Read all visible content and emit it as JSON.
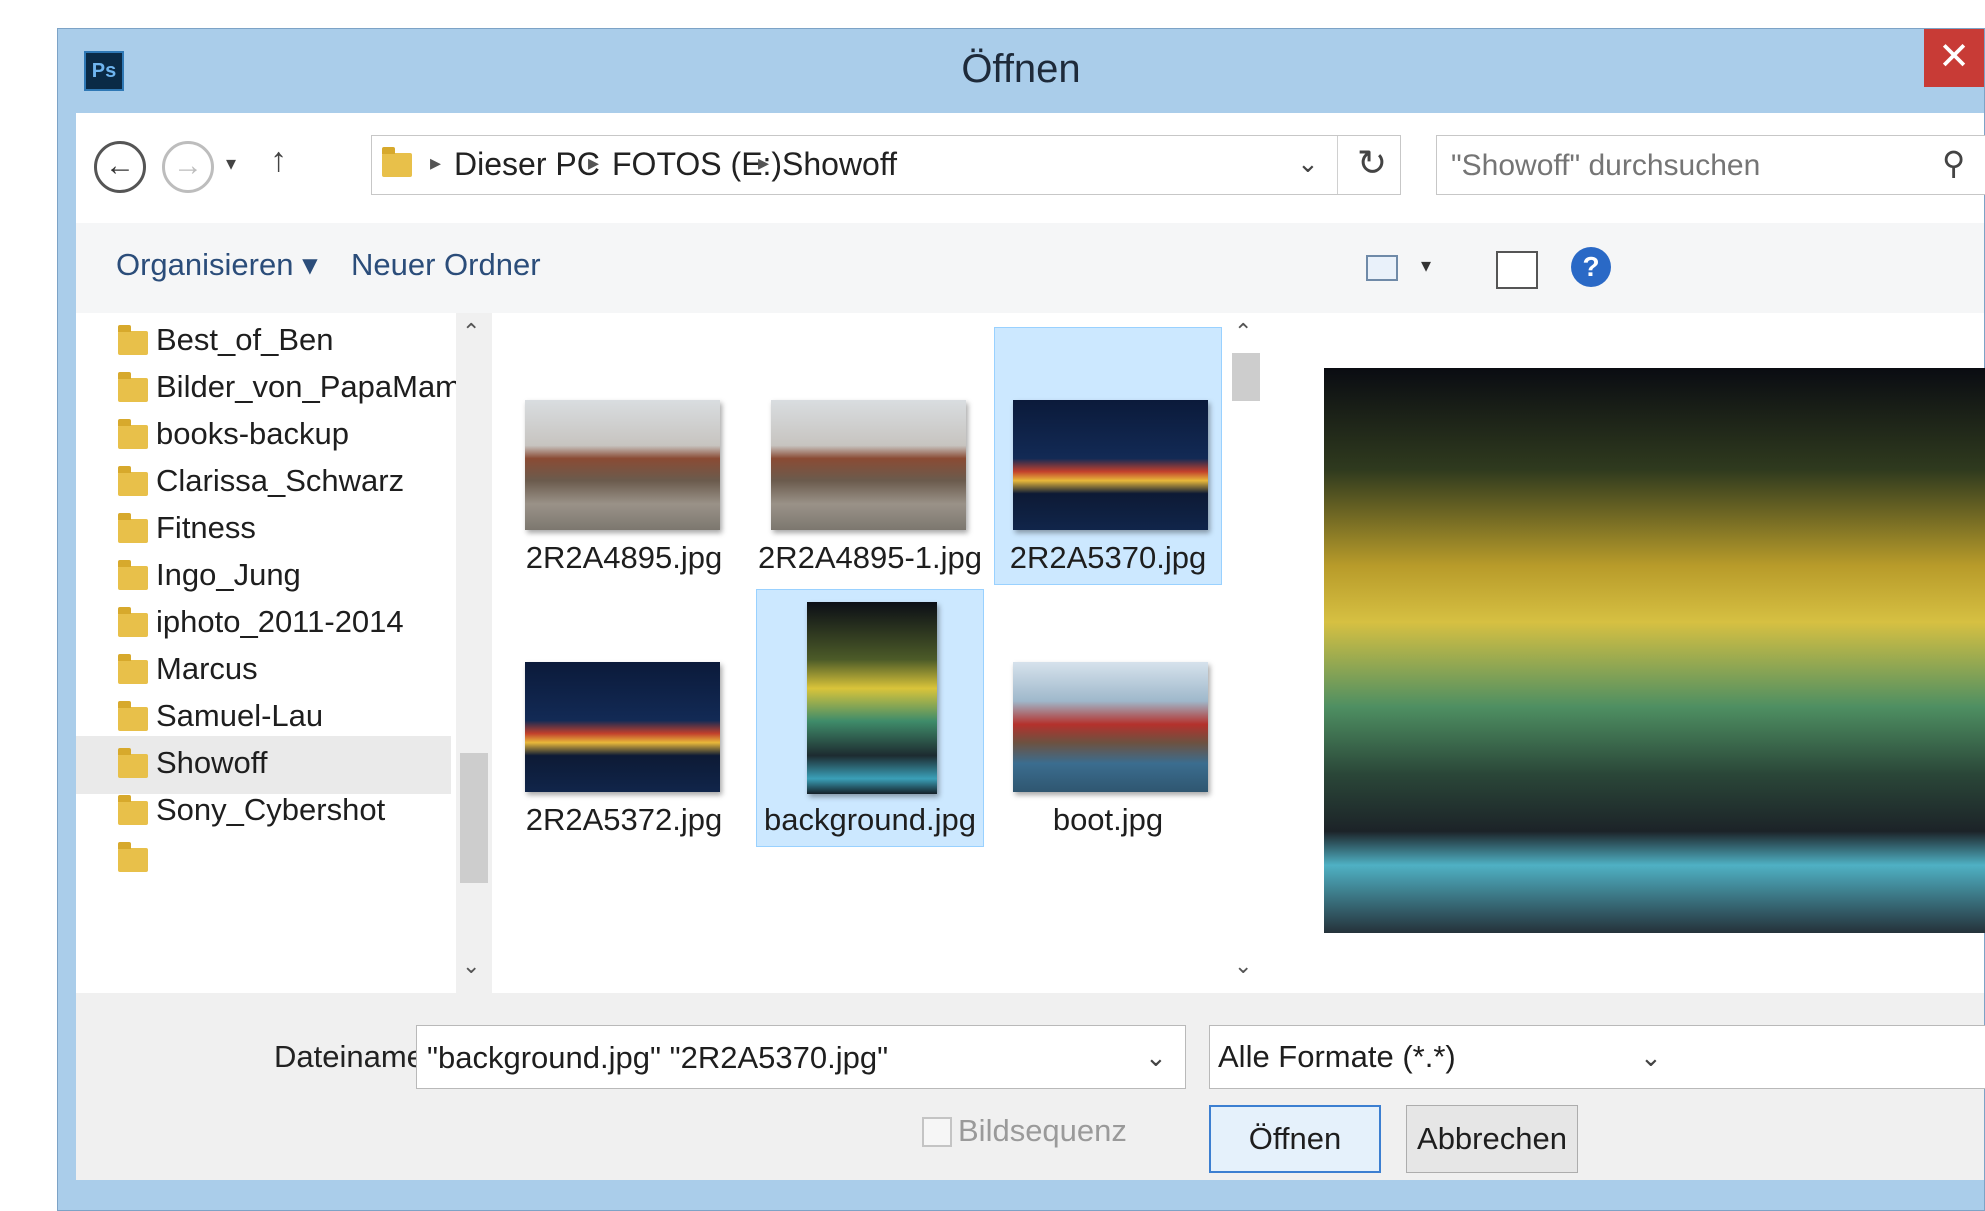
{
  "window": {
    "title": "Öffnen",
    "app_icon": "Ps",
    "close_glyph": "✕"
  },
  "nav": {
    "back_glyph": "←",
    "forward_glyph": "→",
    "recent_glyph": "▾",
    "up_glyph": "↑"
  },
  "address": {
    "crumbs": [
      "Dieser PC",
      "FOTOS (E:)",
      "Showoff"
    ],
    "separator_glyph": "▸",
    "dropdown_glyph": "⌄",
    "refresh_glyph": "↻"
  },
  "search": {
    "placeholder": "\"Showoff\" durchsuchen",
    "icon_glyph": "⚲"
  },
  "toolbar": {
    "organize_label": "Organisieren ▾",
    "new_folder_label": "Neuer Ordner",
    "view_caret": "▾",
    "help_glyph": "?"
  },
  "sidebar": {
    "items": [
      {
        "label": "Best_of_Ben",
        "selected": false
      },
      {
        "label": "Bilder_von_PapaMama",
        "selected": false
      },
      {
        "label": "books-backup",
        "selected": false
      },
      {
        "label": "Clarissa_Schwarz",
        "selected": false
      },
      {
        "label": "Fitness",
        "selected": false
      },
      {
        "label": "Ingo_Jung",
        "selected": false
      },
      {
        "label": "iphoto_2011-2014",
        "selected": false
      },
      {
        "label": "Marcus",
        "selected": false
      },
      {
        "label": "Samuel-Lau",
        "selected": false
      },
      {
        "label": "Showoff",
        "selected": true
      },
      {
        "label": "Sony_Cybershot",
        "selected": false
      }
    ],
    "scroll_up_glyph": "⌃",
    "scroll_down_glyph": "⌄"
  },
  "files": {
    "items": [
      {
        "name": "2R2A4895.jpg",
        "thumb": "temple",
        "selected": false
      },
      {
        "name": "2R2A4895-1.jpg",
        "thumb": "temple",
        "selected": false
      },
      {
        "name": "2R2A5370.jpg",
        "thumb": "bird",
        "selected": true
      },
      {
        "name": "2R2A5372.jpg",
        "thumb": "bird",
        "selected": false
      },
      {
        "name": "background.jpg",
        "thumb": "night",
        "selected": true
      },
      {
        "name": "boot.jpg",
        "thumb": "boat",
        "selected": false
      }
    ]
  },
  "bottom": {
    "filename_label": "Dateiname:",
    "filename_value": "\"background.jpg\" \"2R2A5370.jpg\"",
    "format_value": "Alle Formate (*.*)",
    "sequence_label": "Bildsequenz",
    "sequence_checked": false,
    "open_label": "Öffnen",
    "cancel_label": "Abbrechen",
    "dropdown_glyph": "⌄"
  },
  "colors": {
    "title_bar": "#aacdea",
    "close_button": "#c83b36",
    "selection_fill": "#cce8ff",
    "selection_border": "#99d1ff",
    "folder": "#e8c04a",
    "link_text": "#2b4d7a"
  }
}
